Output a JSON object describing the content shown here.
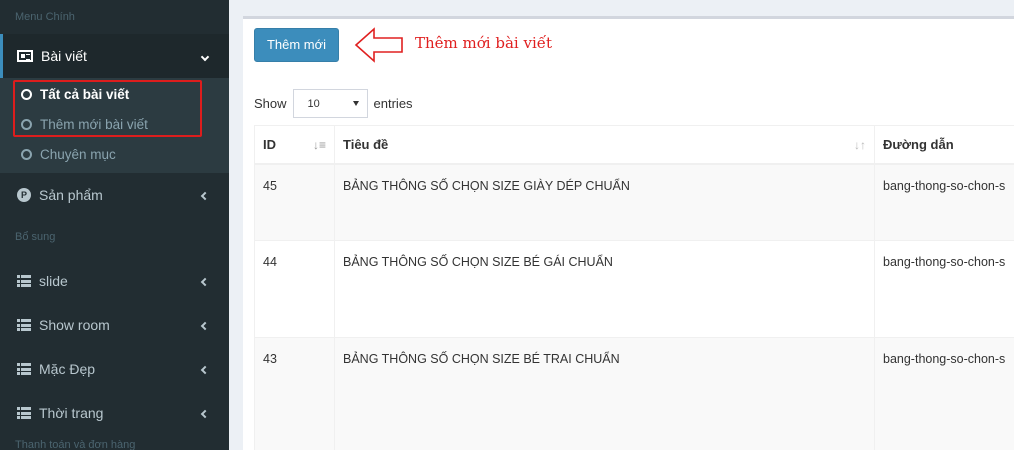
{
  "sidebar": {
    "section_main": "Menu Chính",
    "section_extra": "Bổ sung",
    "section_orders": "Thanh toán và đơn hàng",
    "posts_label": "Bài viết",
    "posts_sub": [
      "Tất cả bài viết",
      "Thêm mới bài viết",
      "Chuyên mục"
    ],
    "products_label": "Sản phẩm",
    "extra_items": [
      "slide",
      "Show room",
      "Mặc Đẹp",
      "Thời trang"
    ]
  },
  "main": {
    "add_button": "Thêm mới",
    "annotation": "Thêm mới bài viết",
    "show_label": "Show",
    "entries_value": "10",
    "entries_label": "entries",
    "columns": [
      "ID",
      "Tiêu đề",
      "Đường dẫn"
    ],
    "rows": [
      {
        "id": "45",
        "title": "BẢNG THÔNG SỐ CHỌN SIZE GIÀY DÉP CHUẨN",
        "slug": "bang-thong-so-chon-s"
      },
      {
        "id": "44",
        "title": "BẢNG THÔNG SỐ CHỌN SIZE BÉ GÁI CHUẨN",
        "slug": "bang-thong-so-chon-s"
      },
      {
        "id": "43",
        "title": "BẢNG THÔNG SỐ CHỌN SIZE BÉ TRAI CHUẨN",
        "slug": "bang-thong-so-chon-s"
      }
    ]
  },
  "colors": {
    "sidebar_bg": "#222d32",
    "primary": "#3c8dbc",
    "annotation": "#e02020"
  }
}
